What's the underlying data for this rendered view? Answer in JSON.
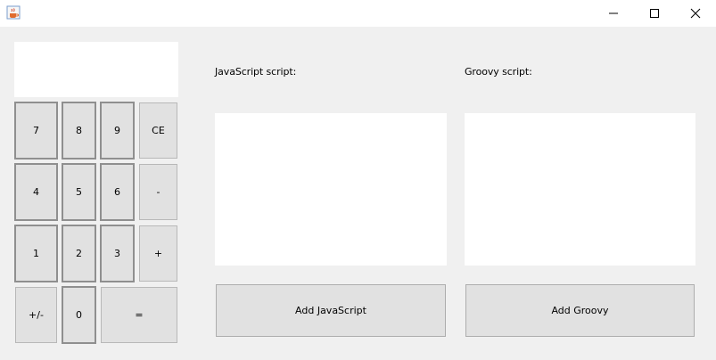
{
  "window": {
    "app_icon": "java-cup-icon",
    "controls": [
      "minimize-icon",
      "maximize-icon",
      "close-icon"
    ]
  },
  "calculator": {
    "display_value": "",
    "keys": {
      "k7": "7",
      "k8": "8",
      "k9": "9",
      "ce": "CE",
      "k4": "4",
      "k5": "5",
      "k6": "6",
      "minus": "-",
      "k1": "1",
      "k2": "2",
      "k3": "3",
      "plus": "+",
      "negate": "+/-",
      "k0": "0",
      "equals": "="
    }
  },
  "javascript": {
    "label": "JavaScript script:",
    "content": "",
    "add_button": "Add JavaScript"
  },
  "groovy": {
    "label": "Groovy script:",
    "content": "",
    "add_button": "Add Groovy"
  }
}
